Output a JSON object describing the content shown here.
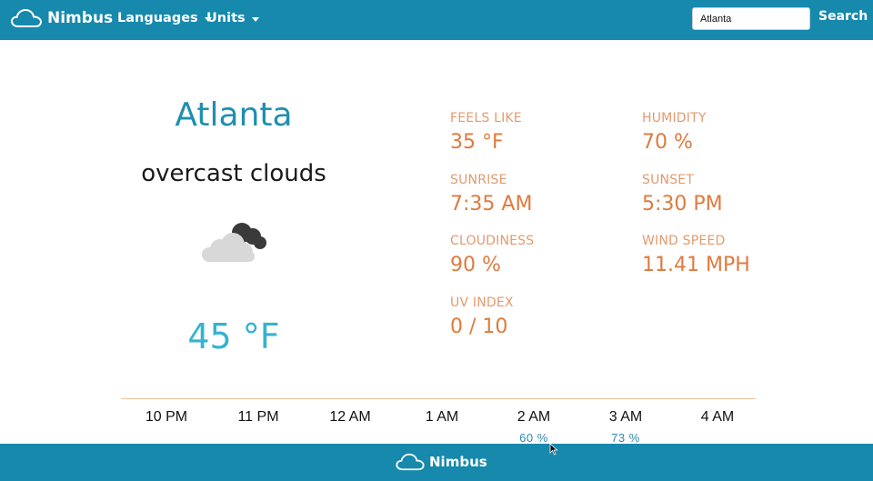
{
  "nav": {
    "brand": "Nimbus",
    "languages_label": "Languages",
    "units_label": "Units",
    "search_value": "Atlanta",
    "search_button": "Search"
  },
  "current": {
    "city": "Atlanta",
    "description": "overcast clouds",
    "icon": "overcast-clouds-icon",
    "temperature": "45 °F"
  },
  "details": [
    {
      "label": "FEELS LIKE",
      "value": "35 °F"
    },
    {
      "label": "HUMIDITY",
      "value": "70 %"
    },
    {
      "label": "SUNRISE",
      "value": "7:35 AM"
    },
    {
      "label": "SUNSET",
      "value": "5:30 PM"
    },
    {
      "label": "CLOUDINESS",
      "value": "90 %"
    },
    {
      "label": "WIND SPEED",
      "value": "11.41 MPH"
    },
    {
      "label": "UV INDEX",
      "value": "0 / 10"
    }
  ],
  "hourly": [
    {
      "time": "10 PM",
      "precip": ""
    },
    {
      "time": "11 PM",
      "precip": ""
    },
    {
      "time": "12 AM",
      "precip": ""
    },
    {
      "time": "1 AM",
      "precip": ""
    },
    {
      "time": "2 AM",
      "precip": "60 %"
    },
    {
      "time": "3 AM",
      "precip": "73 %"
    },
    {
      "time": "4 AM",
      "precip": ""
    }
  ],
  "footer": {
    "brand": "Nimbus"
  },
  "colors": {
    "primary": "#1689ad",
    "city": "#1f8fb0",
    "temperature": "#36b3cf",
    "detail_label": "#e39a6e",
    "detail_value": "#e07a3e",
    "precip": "#2a8ab0"
  }
}
